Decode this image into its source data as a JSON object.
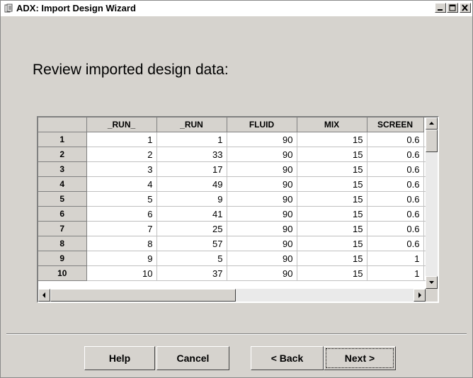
{
  "window": {
    "title": "ADX: Import Design Wizard"
  },
  "heading": "Review imported design data:",
  "grid": {
    "columns": [
      "_RUN_",
      "_RUN",
      "FLUID",
      "MIX",
      "SCREEN"
    ],
    "rows": [
      {
        "row": "1",
        "cells": [
          "1",
          "1",
          "90",
          "15",
          "0.6"
        ]
      },
      {
        "row": "2",
        "cells": [
          "2",
          "33",
          "90",
          "15",
          "0.6"
        ]
      },
      {
        "row": "3",
        "cells": [
          "3",
          "17",
          "90",
          "15",
          "0.6"
        ]
      },
      {
        "row": "4",
        "cells": [
          "4",
          "49",
          "90",
          "15",
          "0.6"
        ]
      },
      {
        "row": "5",
        "cells": [
          "5",
          "9",
          "90",
          "15",
          "0.6"
        ]
      },
      {
        "row": "6",
        "cells": [
          "6",
          "41",
          "90",
          "15",
          "0.6"
        ]
      },
      {
        "row": "7",
        "cells": [
          "7",
          "25",
          "90",
          "15",
          "0.6"
        ]
      },
      {
        "row": "8",
        "cells": [
          "8",
          "57",
          "90",
          "15",
          "0.6"
        ]
      },
      {
        "row": "9",
        "cells": [
          "9",
          "5",
          "90",
          "15",
          "1"
        ]
      },
      {
        "row": "10",
        "cells": [
          "10",
          "37",
          "90",
          "15",
          "1"
        ]
      }
    ]
  },
  "buttons": {
    "help": "Help",
    "cancel": "Cancel",
    "back": "< Back",
    "next": "Next >"
  },
  "icons": {
    "app": "wizard-app-icon",
    "minimize": "minimize-icon",
    "maximize": "maximize-icon",
    "close": "close-icon"
  }
}
